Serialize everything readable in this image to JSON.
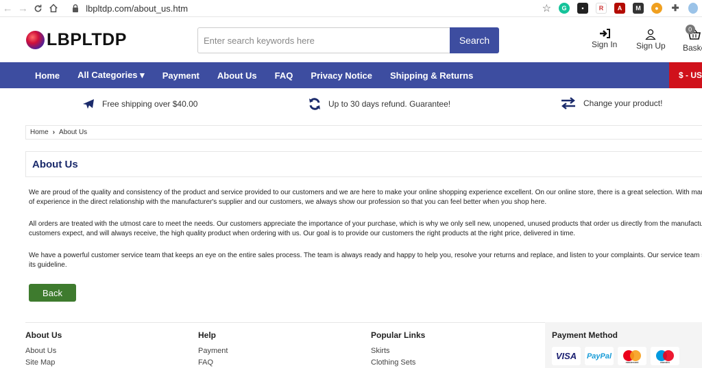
{
  "browser": {
    "url": "lbpltdp.com/about_us.htm"
  },
  "header": {
    "logo_text": "LBPLTDP",
    "search_placeholder": "Enter search keywords here",
    "search_button": "Search",
    "sign_in": "Sign In",
    "sign_up": "Sign Up",
    "basket": "Baske",
    "basket_count": "0"
  },
  "nav": {
    "items": [
      "Home",
      "All Categories ▾",
      "Payment",
      "About Us",
      "FAQ",
      "Privacy Notice",
      "Shipping & Returns"
    ],
    "currency": "$ - US"
  },
  "features": [
    {
      "icon": "plane-icon",
      "text": "Free shipping over $40.00"
    },
    {
      "icon": "refresh-icon",
      "text": "Up to 30 days refund. Guarantee!"
    },
    {
      "icon": "exchange-icon",
      "text": "Change your product!"
    }
  ],
  "breadcrumb": {
    "home": "Home",
    "current": "About Us"
  },
  "page": {
    "title": "About Us",
    "paragraphs": [
      [
        "We are proud of the quality and consistency of the product and service provided to our customers and we are here to make your online shopping experience excellent. On our online store, there is a great selection. With many yea",
        "of experience in the direct relationship with the manufacturer's supplier and our customers, we always show our profession so that you can feel better when you shop here."
      ],
      [
        "All orders are treated with the utmost care to meet the needs. Our customers appreciate the importance of your purchase, which is why we only sell new, unopened, unused products that order us directly from the manufacturer. C",
        "customers expect, and will always receive, the high quality product when ordering with us. Our goal is to provide our customers the right products at the right price, delivered in time."
      ],
      [
        "We have a powerful customer service team that keeps an eye on the entire sales process. The team is always ready and happy to help you, resolve your returns and replace, and listen to your complaints. Our service team sticks",
        "its guideline."
      ]
    ],
    "back_button": "Back"
  },
  "footer": {
    "about": {
      "heading": "About Us",
      "links": [
        "About Us",
        "Site Map"
      ]
    },
    "help": {
      "heading": "Help",
      "links": [
        "Payment",
        "FAQ"
      ]
    },
    "popular": {
      "heading": "Popular Links",
      "links": [
        "Skirts",
        "Clothing Sets"
      ]
    },
    "payment": {
      "heading": "Payment Method",
      "cards": [
        "VISA",
        "PayPal",
        "mastercard",
        "maestro"
      ]
    }
  },
  "colors": {
    "nav_bg": "#3d4da0",
    "currency_bg": "#d0111b",
    "back_button": "#3e7b2e",
    "title": "#1a2a6b"
  }
}
